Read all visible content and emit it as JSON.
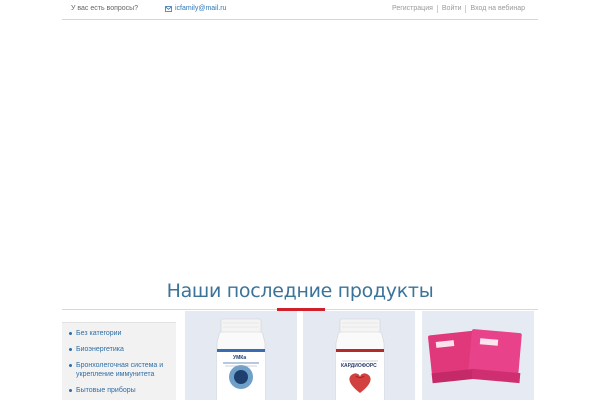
{
  "topbar": {
    "question": "У вас есть вопросы?",
    "email": "icfamily@mail.ru",
    "links": [
      "Регистрация",
      "Войти",
      "Вход на вебинар"
    ]
  },
  "section": {
    "title": "Наши последние продукты"
  },
  "sidebar": {
    "categories": [
      "Без категории",
      "Биоэнергетика",
      "Бронхолегочная система и укрепление иммунитета",
      "Бытовые приборы"
    ]
  },
  "products": [
    {
      "label": "УМКа"
    },
    {
      "label": "КАРДИОФОРС"
    },
    {
      "label": ""
    }
  ],
  "colors": {
    "accent": "#d0202b",
    "title": "#3c7399",
    "link": "#2f6ea6"
  }
}
